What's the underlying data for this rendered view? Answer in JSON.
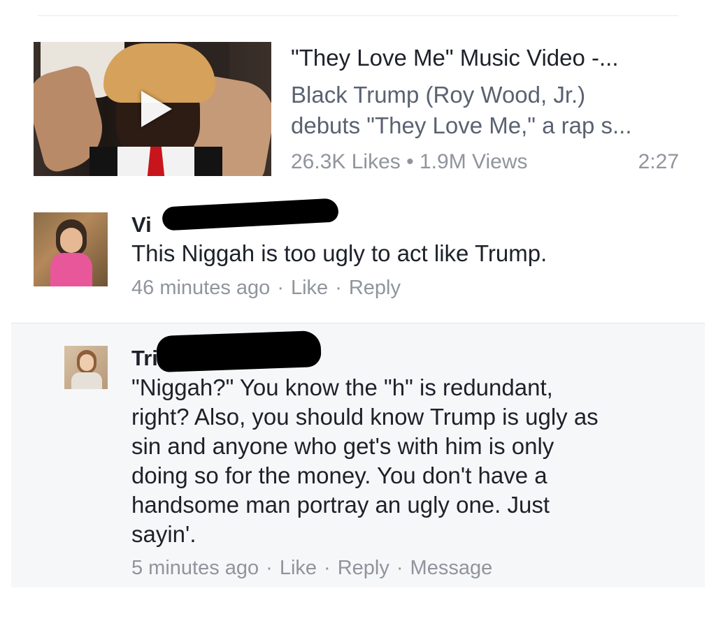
{
  "video": {
    "title": "\"They Love Me\" Music Video -...",
    "description_lines": [
      "Black Trump (Roy Wood, Jr.)",
      "debuts \"They Love Me,\" a rap s..."
    ],
    "likes": "26.3K Likes",
    "bullet": "•",
    "views": "1.9M Views",
    "duration": "2:27"
  },
  "comments": [
    {
      "author": "Vi",
      "text": "This Niggah is too ugly to act like Trump.",
      "time": "46 minutes ago",
      "like": "Like",
      "reply": "Reply"
    },
    {
      "author": "Tri",
      "text_lines": [
        "\"Niggah?\" You know the \"h\" is redundant,",
        "right? Also, you should know Trump is ugly as",
        "sin and anyone who get's with him is only",
        "doing so for the money. You don't have a",
        "handsome man portray an ugly one. Just",
        "sayin'."
      ],
      "time": "5 minutes ago",
      "like": "Like",
      "reply": "Reply",
      "message": "Message"
    }
  ],
  "separator": "·",
  "colors": {
    "text": "#1d2129",
    "secondary": "#90949c",
    "description": "#5a6270",
    "reply_background": "#f6f7f9"
  }
}
